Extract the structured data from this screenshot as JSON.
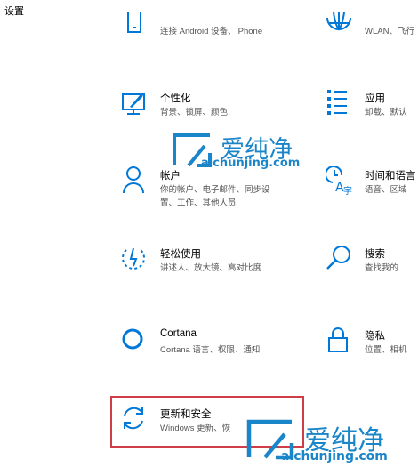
{
  "window": {
    "title": "设置"
  },
  "tiles": [
    {
      "id": "phone",
      "icon": "phone-icon",
      "name": "",
      "desc": "连接 Android 设备、iPhone"
    },
    {
      "id": "network",
      "icon": "globe-icon",
      "name": "",
      "desc": "WLAN、飞行"
    },
    {
      "id": "personalization",
      "icon": "paint-brush-icon",
      "name": "个性化",
      "desc": "背景、锁屏、颜色"
    },
    {
      "id": "apps",
      "icon": "apps-list-icon",
      "name": "应用",
      "desc": "卸载、默认"
    },
    {
      "id": "accounts",
      "icon": "person-icon",
      "name": "帐户",
      "desc": "你的帐户、电子邮件、同步设\n置、工作、其他人员"
    },
    {
      "id": "time-language",
      "icon": "time-language-icon",
      "name": "时间和语言",
      "desc": "语音、区域"
    },
    {
      "id": "ease-of-access",
      "icon": "ease-of-access-icon",
      "name": "轻松使用",
      "desc": "讲述人、放大镜、高对比度"
    },
    {
      "id": "search",
      "icon": "search-icon",
      "name": "搜索",
      "desc": "查找我的"
    },
    {
      "id": "cortana",
      "icon": "cortana-icon",
      "name": "Cortana",
      "desc": "Cortana 语言、权限、通知"
    },
    {
      "id": "privacy",
      "icon": "lock-icon",
      "name": "隐私",
      "desc": "位置、相机"
    },
    {
      "id": "update-security",
      "icon": "sync-icon",
      "name": "更新和安全",
      "desc": "Windows 更新、恢"
    }
  ],
  "watermark": {
    "cn": "爱纯净",
    "url": "aichunjing.com"
  },
  "colors": {
    "accent": "#0078d7",
    "highlight_border": "#cf3e47",
    "watermark": "#1a85c8"
  }
}
